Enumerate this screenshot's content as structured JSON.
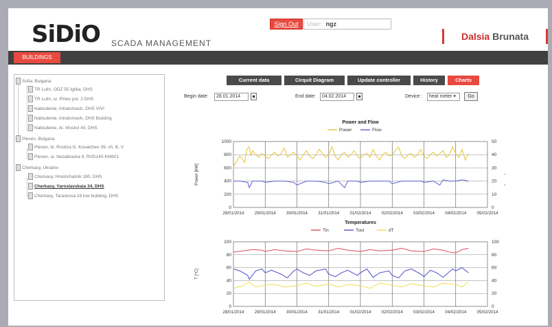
{
  "header": {
    "logo": "SiDiO",
    "subtitle": "SCADA MANAGEMENT",
    "signout_label": "Sign Out",
    "user_label": "User:",
    "user_name": "ngz",
    "brand_part1": "Dalsia",
    "brand_part2": "Brunata"
  },
  "nav": {
    "buildings_label": "BUILDINGS"
  },
  "tree": {
    "groups": [
      {
        "label": "Sofia, Bulgaria",
        "items": [
          "TR Lulin, ODZ 55 Iglika, DHS",
          "TR Lulin, ul. Pirtev pst. 2 DHS",
          "Nakludenie, Intratomash, DHS VIVI",
          "Nakludenie, Intratomash, DHS Building",
          "Nakludenie, Al. Moskvi 40, DHS"
        ]
      },
      {
        "label": "Pleven, Bulgaria",
        "items": [
          "Pleven, bl. Rositza G. Kovatchev 39, vh. B, V",
          "Pleven, ul. Nezabravka 9, RVD140-KM601"
        ]
      },
      {
        "label": "Cherkasy, Ukraine",
        "items": [
          "Cherkasy, Hreshchatnik 180, DHS",
          "Cherkasy, Yaroslavskaia 34, DHS",
          "Cherkasy, Taraskova 16 low building, DHS"
        ]
      }
    ],
    "selected": "Cherkasy, Yaroslavskaia 34, DHS"
  },
  "tabs": [
    {
      "label": "Current data",
      "active": false
    },
    {
      "label": "Cirquit Diagram",
      "active": false
    },
    {
      "label": "Update controller",
      "active": false
    },
    {
      "label": "History",
      "active": false
    },
    {
      "label": "Charts",
      "active": true
    }
  ],
  "filters": {
    "begin_label": "Begin date:",
    "begin_value": "28.01.2014",
    "end_label": "End date:",
    "end_value": "04.02.2014",
    "device_label": "Device :",
    "device_value": "heat meter",
    "go_label": "Go"
  },
  "colors": {
    "accent": "#e84a3f",
    "navbar": "#404040",
    "power": "#e8c84a",
    "flow": "#6a6ad8",
    "tin": "#e05a6a",
    "tout": "#5a5ad0",
    "dt": "#f0e060"
  },
  "chart_data": [
    {
      "type": "line",
      "title": "Power and Flow",
      "xlabel": "",
      "ylabel": "Power [kW]",
      "y2label": "Flow [m3/h]",
      "x_ticks": [
        "28/01/2014",
        "29/01/2014",
        "30/01/2014",
        "31/01/2014",
        "01/02/2014",
        "02/02/2014",
        "03/02/2014",
        "04/02/2014",
        "05/02/2014"
      ],
      "xlim": [
        "28/01/2014",
        "05/02/2014"
      ],
      "ylim": [
        0,
        1000
      ],
      "y_ticks": [
        0,
        200,
        400,
        600,
        800,
        1000
      ],
      "y2lim": [
        0,
        50
      ],
      "y2_ticks": [
        0,
        10,
        20,
        30,
        40,
        50
      ],
      "grid": true,
      "legend": "top-center",
      "series": [
        {
          "name": "Power",
          "axis": "left",
          "color": "#e8c84a",
          "x": [
            0,
            0.1,
            0.2,
            0.3,
            0.35,
            0.42,
            0.5,
            0.55,
            0.6,
            0.7,
            0.8,
            0.9,
            1.0,
            1.1,
            1.2,
            1.3,
            1.4,
            1.5,
            1.6,
            1.7,
            1.8,
            1.9,
            2.0,
            2.1,
            2.2,
            2.3,
            2.4,
            2.5,
            2.6,
            2.7,
            2.8,
            2.9,
            3.0,
            3.1,
            3.2,
            3.3,
            3.4,
            3.5,
            3.6,
            3.7,
            3.8,
            3.9,
            4.0,
            4.1,
            4.2,
            4.3,
            4.4,
            4.5,
            4.6,
            4.7,
            4.8,
            4.9,
            5.0,
            5.1,
            5.2,
            5.3,
            5.4,
            5.5,
            5.6,
            5.7,
            5.8,
            5.9,
            6.0,
            6.1,
            6.2,
            6.3,
            6.4,
            6.5,
            6.6,
            6.7,
            6.8,
            6.9,
            7.0,
            7.1,
            7.2,
            7.3,
            7.4
          ],
          "y": [
            620,
            700,
            780,
            720,
            680,
            880,
            920,
            780,
            860,
            800,
            760,
            820,
            780,
            740,
            800,
            840,
            780,
            820,
            900,
            760,
            800,
            840,
            780,
            720,
            800,
            860,
            780,
            740,
            800,
            880,
            820,
            760,
            800,
            920,
            780,
            720,
            800,
            840,
            760,
            800,
            860,
            780,
            740,
            800,
            820,
            760,
            880,
            780,
            720,
            800,
            840,
            780,
            800,
            860,
            920,
            780,
            740,
            800,
            820,
            760,
            800,
            880,
            780,
            740,
            800,
            840,
            780,
            820,
            860,
            760,
            800,
            920,
            820,
            760,
            880,
            720,
            820
          ]
        },
        {
          "name": "Flow",
          "axis": "right",
          "color": "#6a6ad8",
          "x": [
            0,
            0.2,
            0.45,
            0.5,
            0.6,
            0.9,
            1.0,
            1.3,
            1.6,
            1.9,
            2.0,
            2.3,
            2.6,
            2.9,
            3.0,
            3.3,
            3.5,
            3.6,
            3.9,
            4.0,
            4.3,
            4.6,
            4.9,
            5.0,
            5.3,
            5.6,
            5.9,
            6.0,
            6.3,
            6.5,
            6.6,
            6.8,
            7.0,
            7.2,
            7.4
          ],
          "y": [
            20,
            20,
            19,
            15,
            20,
            20,
            19,
            20,
            20,
            19,
            17,
            20,
            20,
            19,
            18,
            20,
            15,
            20,
            20,
            19,
            20,
            20,
            20,
            18,
            20,
            20,
            20,
            19,
            20,
            17,
            21,
            20,
            20,
            21,
            20
          ]
        }
      ]
    },
    {
      "type": "line",
      "title": "Temperatures",
      "xlabel": "",
      "ylabel": "T [°C]",
      "x_ticks": [
        "28/01/2014",
        "29/01/2014",
        "30/01/2014",
        "31/01/2014",
        "01/02/2014",
        "02/02/2014",
        "03/02/2014",
        "04/02/2014",
        "05/02/2014"
      ],
      "xlim": [
        "28/01/2014",
        "05/02/2014"
      ],
      "ylim": [
        0,
        100
      ],
      "y_ticks": [
        0,
        20,
        40,
        60,
        80,
        100
      ],
      "y2lim": [
        0,
        100
      ],
      "y2_ticks": [
        0,
        20,
        40,
        60,
        80,
        100
      ],
      "grid": true,
      "legend": "top-center",
      "series": [
        {
          "name": "Tin",
          "color": "#e05a6a",
          "x": [
            0,
            0.3,
            0.6,
            0.9,
            1.0,
            1.3,
            1.6,
            2.0,
            2.3,
            2.6,
            3.0,
            3.3,
            3.6,
            4.0,
            4.3,
            4.6,
            5.0,
            5.3,
            5.6,
            6.0,
            6.3,
            6.6,
            6.8,
            7.0,
            7.2,
            7.4
          ],
          "y": [
            84,
            86,
            88,
            87,
            85,
            88,
            86,
            85,
            89,
            87,
            86,
            90,
            87,
            85,
            88,
            86,
            87,
            90,
            86,
            85,
            89,
            87,
            84,
            83,
            88,
            90
          ]
        },
        {
          "name": "Tout",
          "color": "#5a5ad0",
          "x": [
            0,
            0.2,
            0.45,
            0.5,
            0.7,
            0.9,
            1.0,
            1.2,
            1.5,
            1.7,
            1.9,
            2.0,
            2.2,
            2.4,
            2.6,
            2.9,
            3.0,
            3.2,
            3.4,
            3.6,
            3.9,
            4.0,
            4.2,
            4.4,
            4.6,
            4.9,
            5.0,
            5.2,
            5.4,
            5.6,
            5.9,
            6.0,
            6.2,
            6.4,
            6.6,
            6.9,
            7.0,
            7.2,
            7.4
          ],
          "y": [
            58,
            55,
            48,
            42,
            55,
            58,
            52,
            56,
            50,
            44,
            55,
            58,
            52,
            48,
            55,
            58,
            50,
            46,
            52,
            56,
            48,
            52,
            58,
            45,
            52,
            55,
            48,
            44,
            55,
            58,
            50,
            46,
            56,
            52,
            45,
            58,
            55,
            60,
            52
          ]
        },
        {
          "name": "dT",
          "color": "#f0e060",
          "x": [
            0,
            0.3,
            0.5,
            0.7,
            1.0,
            1.3,
            1.6,
            2.0,
            2.3,
            2.6,
            3.0,
            3.3,
            3.6,
            4.0,
            4.3,
            4.6,
            5.0,
            5.3,
            5.6,
            6.0,
            6.3,
            6.6,
            7.0,
            7.2,
            7.4
          ],
          "y": [
            28,
            32,
            38,
            30,
            33,
            34,
            30,
            32,
            36,
            31,
            35,
            30,
            34,
            32,
            28,
            36,
            33,
            30,
            35,
            32,
            30,
            36,
            34,
            30,
            38
          ]
        }
      ]
    }
  ]
}
